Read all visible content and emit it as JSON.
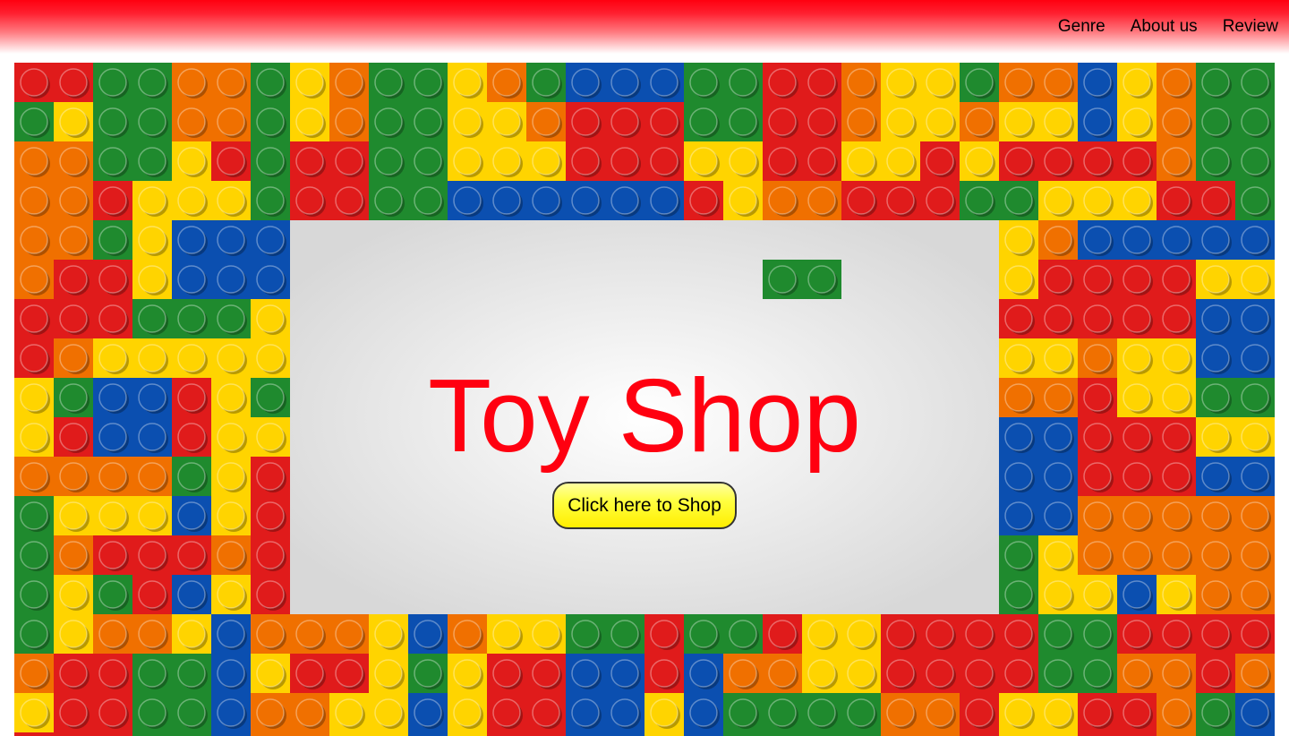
{
  "nav": {
    "items": [
      "Genre",
      "About us",
      "Review"
    ]
  },
  "hero": {
    "title": "Toy Shop",
    "button_label": "Click here to Shop",
    "background_pattern": "colored-toy-bricks"
  },
  "colors": {
    "topbar_red": "#ff0010",
    "title_red": "#ff0010",
    "button_yellow": "#ffff40",
    "brick_red": "#e01b1b",
    "brick_green": "#1f8a2e",
    "brick_yellow": "#ffd400",
    "brick_orange": "#f07000",
    "brick_blue": "#0b4fb0"
  }
}
